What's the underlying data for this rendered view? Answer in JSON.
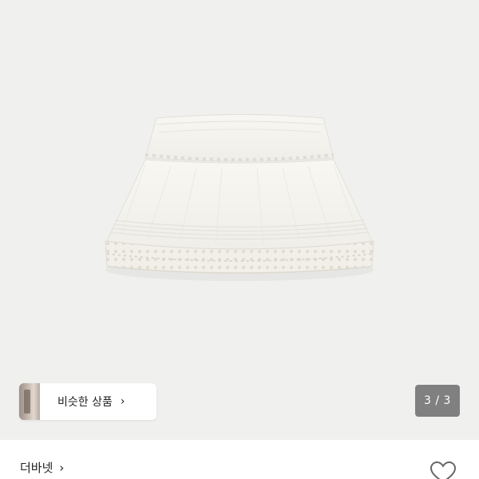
{
  "product": {
    "image_alt": "white tiered ruffle mini skirt",
    "image_background": "#f0f0ef"
  },
  "similar_products": {
    "label": "비슷한 상품",
    "chevron": "›",
    "thumbnail_icon": "similar-product-thumbnail"
  },
  "gallery": {
    "counter": "3 / 3"
  },
  "store": {
    "name": "더바넷",
    "chevron": "›"
  },
  "actions": {
    "like_icon": "heart-outline-icon"
  },
  "colors": {
    "counter_bg": "#606060",
    "text": "#222222",
    "image_bg": "#f0f0ef"
  }
}
